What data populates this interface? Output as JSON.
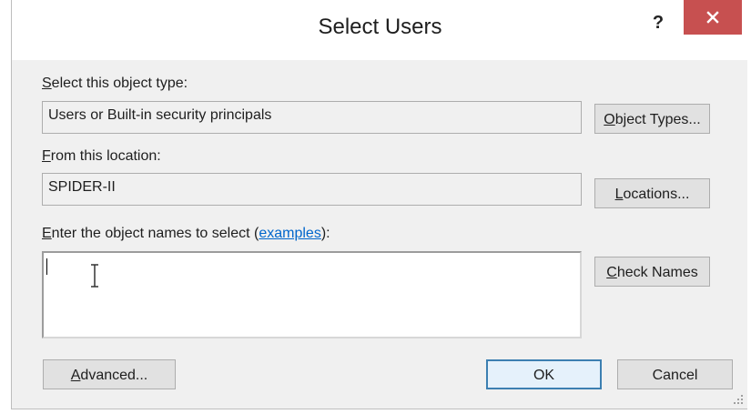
{
  "window": {
    "title": "Select Users",
    "help_label": "?",
    "close_icon": "close-icon"
  },
  "object_type": {
    "label_mnemonic": "S",
    "label_rest": "elect this object type:",
    "value": "Users or Built-in security principals",
    "button_mnemonic": "O",
    "button_rest": "bject Types..."
  },
  "location": {
    "label_mnemonic": "F",
    "label_rest": "rom this location:",
    "value": "SPIDER-II",
    "button_mnemonic": "L",
    "button_rest": "ocations..."
  },
  "names": {
    "label_mnemonic": "E",
    "label_rest": "nter the object names to select (",
    "link": "examples",
    "label_end": "):",
    "value": "",
    "button_mnemonic": "C",
    "button_rest": "heck Names"
  },
  "footer": {
    "advanced_mnemonic": "A",
    "advanced_rest": "dvanced...",
    "ok_label": "OK",
    "cancel_label": "Cancel"
  },
  "colors": {
    "close_bg": "#c75050",
    "dialog_bg": "#f0f0f0",
    "link": "#0066cc",
    "default_button_border": "#3c7fb1"
  }
}
